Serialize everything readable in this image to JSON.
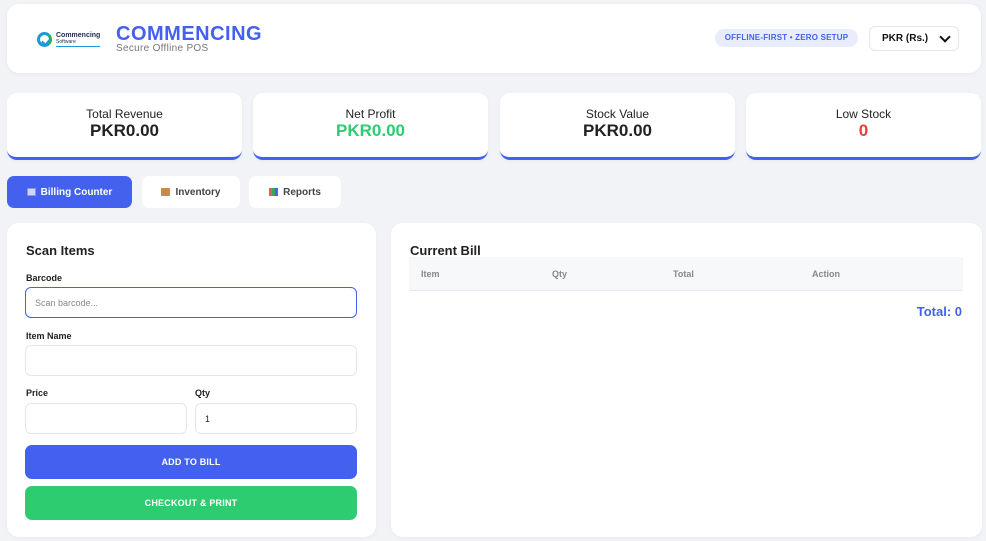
{
  "header": {
    "logo_line1": "Commencing",
    "logo_line2": "Software",
    "title": "COMMENCING",
    "subtitle": "Secure Offline POS",
    "badge": "OFFLINE-FIRST • ZERO SETUP",
    "currency": "PKR (Rs.)"
  },
  "stats": [
    {
      "label": "Total Revenue",
      "value": "PKR0.00",
      "color": "#222222"
    },
    {
      "label": "Net Profit",
      "value": "PKR0.00",
      "color": "#2ecc71"
    },
    {
      "label": "Stock Value",
      "value": "PKR0.00",
      "color": "#222222"
    },
    {
      "label": "Low Stock",
      "value": "0",
      "color": "#e53e3e"
    }
  ],
  "tabs": [
    {
      "label": "Billing Counter",
      "icon": "credit-card-icon",
      "active": true
    },
    {
      "label": "Inventory",
      "icon": "box-icon",
      "active": false
    },
    {
      "label": "Reports",
      "icon": "bar-chart-icon",
      "active": false
    }
  ],
  "scan": {
    "title": "Scan Items",
    "barcode_label": "Barcode",
    "barcode_placeholder": "Scan barcode...",
    "name_label": "Item Name",
    "price_label": "Price",
    "qty_label": "Qty",
    "qty_value": "1",
    "add_button": "ADD TO BILL",
    "checkout_button": "CHECKOUT & PRINT"
  },
  "bill": {
    "title": "Current Bill",
    "columns": [
      "Item",
      "Qty",
      "Total",
      "Action"
    ],
    "total": "Total: 0"
  },
  "colors": {
    "accent": "#4361ee",
    "success": "#2ecc71",
    "danger": "#e53e3e"
  }
}
